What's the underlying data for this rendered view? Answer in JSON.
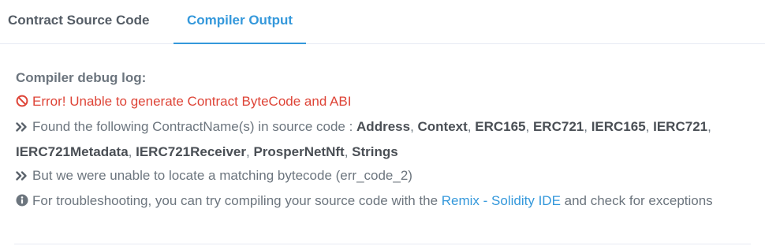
{
  "tabs": {
    "source_label": "Contract Source Code",
    "compiler_label": "Compiler Output",
    "active": "Compiler Output"
  },
  "colors": {
    "accent": "#3498db",
    "error": "#de4437",
    "text": "#6c757e"
  },
  "log": {
    "heading": "Compiler debug log:",
    "error_text": "Error! Unable to generate Contract ByteCode and ABI",
    "found_prefix": "Found the following ContractName(s) in source code : ",
    "contract_names": [
      "Address",
      "Context",
      "ERC165",
      "ERC721",
      "IERC165",
      "IERC721",
      "IERC721Metadata",
      "IERC721Receiver",
      "ProsperNetNft",
      "Strings"
    ],
    "bytecode_text": "But we were unable to locate a matching bytecode (err_code_2)",
    "troubleshoot_prefix": "For troubleshooting, you can try compiling your source code with the ",
    "remix_link": "Remix - Solidity IDE",
    "troubleshoot_suffix": " and check for exceptions",
    "icons": [
      "ban-icon",
      "double-chevron-right-icon",
      "info-circle-icon"
    ]
  }
}
